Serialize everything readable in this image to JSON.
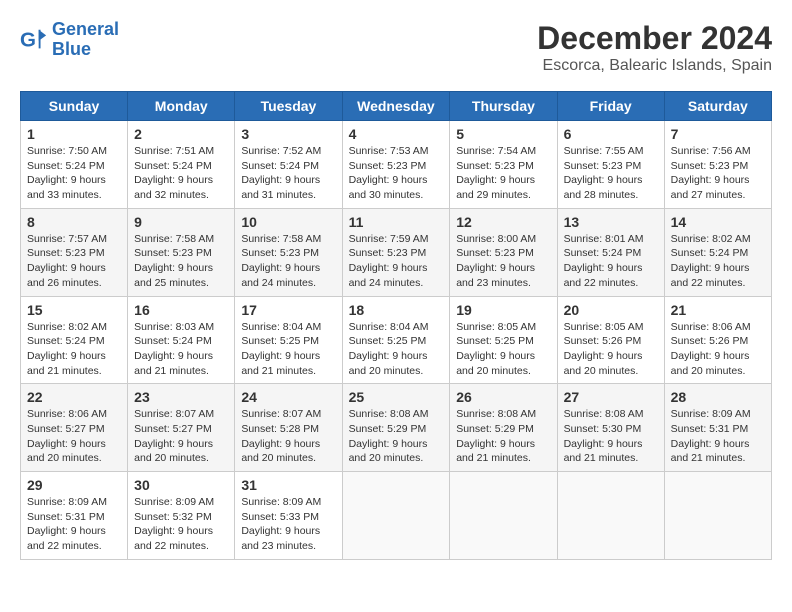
{
  "header": {
    "logo_general": "General",
    "logo_blue": "Blue",
    "title": "December 2024",
    "subtitle": "Escorca, Balearic Islands, Spain"
  },
  "weekdays": [
    "Sunday",
    "Monday",
    "Tuesday",
    "Wednesday",
    "Thursday",
    "Friday",
    "Saturday"
  ],
  "weeks": [
    [
      {
        "day": "1",
        "sunrise": "Sunrise: 7:50 AM",
        "sunset": "Sunset: 5:24 PM",
        "daylight": "Daylight: 9 hours and 33 minutes."
      },
      {
        "day": "2",
        "sunrise": "Sunrise: 7:51 AM",
        "sunset": "Sunset: 5:24 PM",
        "daylight": "Daylight: 9 hours and 32 minutes."
      },
      {
        "day": "3",
        "sunrise": "Sunrise: 7:52 AM",
        "sunset": "Sunset: 5:24 PM",
        "daylight": "Daylight: 9 hours and 31 minutes."
      },
      {
        "day": "4",
        "sunrise": "Sunrise: 7:53 AM",
        "sunset": "Sunset: 5:23 PM",
        "daylight": "Daylight: 9 hours and 30 minutes."
      },
      {
        "day": "5",
        "sunrise": "Sunrise: 7:54 AM",
        "sunset": "Sunset: 5:23 PM",
        "daylight": "Daylight: 9 hours and 29 minutes."
      },
      {
        "day": "6",
        "sunrise": "Sunrise: 7:55 AM",
        "sunset": "Sunset: 5:23 PM",
        "daylight": "Daylight: 9 hours and 28 minutes."
      },
      {
        "day": "7",
        "sunrise": "Sunrise: 7:56 AM",
        "sunset": "Sunset: 5:23 PM",
        "daylight": "Daylight: 9 hours and 27 minutes."
      }
    ],
    [
      {
        "day": "8",
        "sunrise": "Sunrise: 7:57 AM",
        "sunset": "Sunset: 5:23 PM",
        "daylight": "Daylight: 9 hours and 26 minutes."
      },
      {
        "day": "9",
        "sunrise": "Sunrise: 7:58 AM",
        "sunset": "Sunset: 5:23 PM",
        "daylight": "Daylight: 9 hours and 25 minutes."
      },
      {
        "day": "10",
        "sunrise": "Sunrise: 7:58 AM",
        "sunset": "Sunset: 5:23 PM",
        "daylight": "Daylight: 9 hours and 24 minutes."
      },
      {
        "day": "11",
        "sunrise": "Sunrise: 7:59 AM",
        "sunset": "Sunset: 5:23 PM",
        "daylight": "Daylight: 9 hours and 24 minutes."
      },
      {
        "day": "12",
        "sunrise": "Sunrise: 8:00 AM",
        "sunset": "Sunset: 5:23 PM",
        "daylight": "Daylight: 9 hours and 23 minutes."
      },
      {
        "day": "13",
        "sunrise": "Sunrise: 8:01 AM",
        "sunset": "Sunset: 5:24 PM",
        "daylight": "Daylight: 9 hours and 22 minutes."
      },
      {
        "day": "14",
        "sunrise": "Sunrise: 8:02 AM",
        "sunset": "Sunset: 5:24 PM",
        "daylight": "Daylight: 9 hours and 22 minutes."
      }
    ],
    [
      {
        "day": "15",
        "sunrise": "Sunrise: 8:02 AM",
        "sunset": "Sunset: 5:24 PM",
        "daylight": "Daylight: 9 hours and 21 minutes."
      },
      {
        "day": "16",
        "sunrise": "Sunrise: 8:03 AM",
        "sunset": "Sunset: 5:24 PM",
        "daylight": "Daylight: 9 hours and 21 minutes."
      },
      {
        "day": "17",
        "sunrise": "Sunrise: 8:04 AM",
        "sunset": "Sunset: 5:25 PM",
        "daylight": "Daylight: 9 hours and 21 minutes."
      },
      {
        "day": "18",
        "sunrise": "Sunrise: 8:04 AM",
        "sunset": "Sunset: 5:25 PM",
        "daylight": "Daylight: 9 hours and 20 minutes."
      },
      {
        "day": "19",
        "sunrise": "Sunrise: 8:05 AM",
        "sunset": "Sunset: 5:25 PM",
        "daylight": "Daylight: 9 hours and 20 minutes."
      },
      {
        "day": "20",
        "sunrise": "Sunrise: 8:05 AM",
        "sunset": "Sunset: 5:26 PM",
        "daylight": "Daylight: 9 hours and 20 minutes."
      },
      {
        "day": "21",
        "sunrise": "Sunrise: 8:06 AM",
        "sunset": "Sunset: 5:26 PM",
        "daylight": "Daylight: 9 hours and 20 minutes."
      }
    ],
    [
      {
        "day": "22",
        "sunrise": "Sunrise: 8:06 AM",
        "sunset": "Sunset: 5:27 PM",
        "daylight": "Daylight: 9 hours and 20 minutes."
      },
      {
        "day": "23",
        "sunrise": "Sunrise: 8:07 AM",
        "sunset": "Sunset: 5:27 PM",
        "daylight": "Daylight: 9 hours and 20 minutes."
      },
      {
        "day": "24",
        "sunrise": "Sunrise: 8:07 AM",
        "sunset": "Sunset: 5:28 PM",
        "daylight": "Daylight: 9 hours and 20 minutes."
      },
      {
        "day": "25",
        "sunrise": "Sunrise: 8:08 AM",
        "sunset": "Sunset: 5:29 PM",
        "daylight": "Daylight: 9 hours and 20 minutes."
      },
      {
        "day": "26",
        "sunrise": "Sunrise: 8:08 AM",
        "sunset": "Sunset: 5:29 PM",
        "daylight": "Daylight: 9 hours and 21 minutes."
      },
      {
        "day": "27",
        "sunrise": "Sunrise: 8:08 AM",
        "sunset": "Sunset: 5:30 PM",
        "daylight": "Daylight: 9 hours and 21 minutes."
      },
      {
        "day": "28",
        "sunrise": "Sunrise: 8:09 AM",
        "sunset": "Sunset: 5:31 PM",
        "daylight": "Daylight: 9 hours and 21 minutes."
      }
    ],
    [
      {
        "day": "29",
        "sunrise": "Sunrise: 8:09 AM",
        "sunset": "Sunset: 5:31 PM",
        "daylight": "Daylight: 9 hours and 22 minutes."
      },
      {
        "day": "30",
        "sunrise": "Sunrise: 8:09 AM",
        "sunset": "Sunset: 5:32 PM",
        "daylight": "Daylight: 9 hours and 22 minutes."
      },
      {
        "day": "31",
        "sunrise": "Sunrise: 8:09 AM",
        "sunset": "Sunset: 5:33 PM",
        "daylight": "Daylight: 9 hours and 23 minutes."
      },
      null,
      null,
      null,
      null
    ]
  ]
}
